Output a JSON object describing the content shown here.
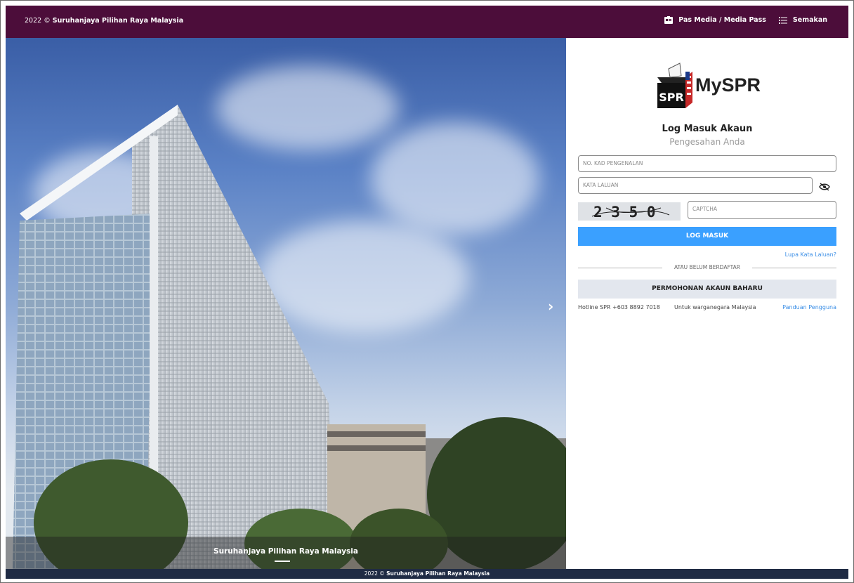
{
  "topbar": {
    "year": "2022",
    "copyright_symbol": "©",
    "org_name": "Suruhanjaya Pilihan Raya Malaysia",
    "links": [
      {
        "label": "Pas Media / Media Pass",
        "icon": "id-card-icon"
      },
      {
        "label": "Semakan",
        "icon": "list-icon"
      }
    ]
  },
  "hero": {
    "caption": "Suruhanjaya Pilihan Raya Malaysia",
    "next_icon": "chevron-right-icon"
  },
  "login": {
    "brand": "MySPR",
    "logo_text": "SPR",
    "title": "Log Masuk Akaun",
    "subtitle": "Pengesahan Anda",
    "ic_placeholder": "NO. KAD PENGENALAN",
    "password_placeholder": "KATA LALUAN",
    "captcha_code": "2 3 5 0",
    "captcha_placeholder": "CAPTCHA",
    "login_button": "LOG MASUK",
    "forgot_link": "Lupa Kata Laluan?",
    "divider_text": "ATAU BELUM BERDAFTAR",
    "register_button": "PERMOHONAN AKAUN BAHARU",
    "hotline": "Hotline SPR +603 8892 7018",
    "citizen_note": "Untuk warganegara Malaysia",
    "guide_link": "Panduan Pengguna"
  },
  "footer": {
    "year": "2022",
    "copyright_symbol": "©",
    "org_name": "Suruhanjaya Pilihan Raya Malaysia"
  },
  "colors": {
    "topbar": "#4c0d3a",
    "footer": "#1f2b44",
    "primary_button": "#3aa0ff",
    "link": "#3a8ee6"
  }
}
